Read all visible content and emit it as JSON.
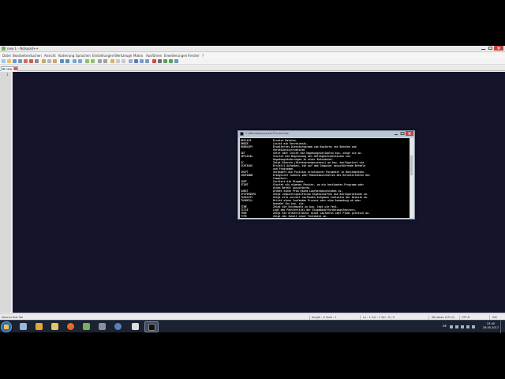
{
  "npp": {
    "title": "new 1 - Notepad++",
    "menu": [
      "Datei",
      "Bearbeiten",
      "Suchen",
      "Ansicht",
      "Kodierung",
      "Sprachen",
      "Einstellungen",
      "Werkzeuge",
      "Makro",
      "Ausführen",
      "Erweiterungen",
      "Fenster",
      "?"
    ],
    "tab_label": "new 1",
    "line_number": "1",
    "status": {
      "type": "Normal text file",
      "length": "length : 0    lines : 1",
      "position": "Ln : 1    Col : 1    Sel : 0 | 0",
      "eol": "Windows (CR LF)",
      "encoding": "UTF-8",
      "mode": "INS"
    }
  },
  "cmd": {
    "title": "C:\\Windows\\system32\\cmd.exe",
    "rows": [
      {
        "k": "REPLACE",
        "d": "Ersetzt Dateien."
      },
      {
        "k": "RMDIR",
        "d": "Löscht ein Verzeichnis."
      },
      {
        "k": "ROBOCOPY",
        "d": "Erweitertes Dienstprogramm zum Kopieren von Dateien und"
      },
      {
        "k": "",
        "d": "Verzeichnisstrukturen"
      },
      {
        "k": "SET",
        "d": "Setzt oder löscht die Umgebungsvariablen bzw. zeigt sie an."
      },
      {
        "k": "SETLOCAL",
        "d": "Startet die Begrenzung des Gültigkeitsbereiches von"
      },
      {
        "k": "",
        "d": "Umgebungsänderungen in einer Batchdatei."
      },
      {
        "k": "SC",
        "d": "Zeigt Dienste (Hintergrundprozesse) an bzw. konfiguriert sie."
      },
      {
        "k": "SCHTASKS",
        "d": "Erstellt Aufgaben, die auf dem Computer auszuführende Befehle"
      },
      {
        "k": "",
        "d": "und Programme."
      },
      {
        "k": "SHIFT",
        "d": "Verändert die Position ersetzbarer Parameter in Batchdateien."
      },
      {
        "k": "SHUTDOWN",
        "d": "Ermöglicht lokales oder Remoteausschalten des Herunterfahren des"
      },
      {
        "k": "",
        "d": "Computers."
      },
      {
        "k": "SORT",
        "d": "Sortiert die Eingabe."
      },
      {
        "k": "START",
        "d": "Startet ein eigenes Fenster, um ein bestimmtes Programm oder"
      },
      {
        "k": "",
        "d": "einen Befehl auszuführen."
      },
      {
        "k": "SUBST",
        "d": "Ordnet einen Pfad einem Laufwerkbuchstaben zu."
      },
      {
        "k": "SYSTEMINFO",
        "d": "Zeigt computerspezifische Eigenschaften und Konfigurationen an."
      },
      {
        "k": "TASKLIST",
        "d": "Zeigt alle zurzeit laufenden Aufgaben inklusive der Dienste an."
      },
      {
        "k": "TASKKILL",
        "d": "Bricht einen laufenden Prozess oder eine Anwendung ab oder"
      },
      {
        "k": "",
        "d": "beendet ihn bzw. sie."
      },
      {
        "k": "TIME",
        "d": "Zeigt die Systemzeit an bzw. legt sie fest."
      },
      {
        "k": "TITLE",
        "d": "Legt den Fenstertitel der Eingabeaufforderungsfensters."
      },
      {
        "k": "TREE",
        "d": "Zeigt die Ordnerstruktur eines Laufwerks oder Pfads grafisch an."
      },
      {
        "k": "TYPE",
        "d": "Zeigt den Inhalt einer Textdatei an."
      }
    ]
  },
  "taskbar": {
    "lang": "DE",
    "time": "23:40",
    "date": "28.05.2017"
  }
}
